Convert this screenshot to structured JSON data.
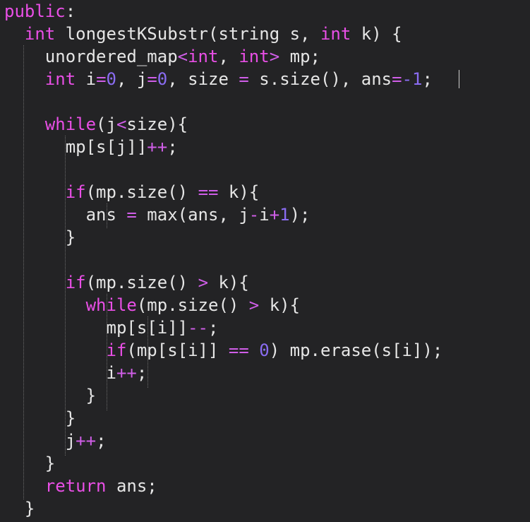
{
  "editor": {
    "theme": {
      "background": "#232325",
      "text": "#e6e6e6",
      "keyword": "#e94fe6",
      "number": "#8a6cf2",
      "operator": "#d05ee8"
    },
    "lines": [
      {
        "indent": 0,
        "row": 0,
        "tokens": [
          [
            "kw",
            "public"
          ],
          [
            "txt",
            ":"
          ]
        ]
      },
      {
        "indent": 1,
        "row": 1,
        "tokens": [
          [
            "kw",
            "int"
          ],
          [
            "txt",
            " longestKSubstr(string s, "
          ],
          [
            "kw",
            "int"
          ],
          [
            "txt",
            " k) {"
          ]
        ]
      },
      {
        "indent": 2,
        "row": 2,
        "tokens": [
          [
            "txt",
            "unordered_map"
          ],
          [
            "op",
            "<"
          ],
          [
            "kw",
            "int"
          ],
          [
            "txt",
            ", "
          ],
          [
            "kw",
            "int"
          ],
          [
            "op",
            ">"
          ],
          [
            "txt",
            " mp;"
          ]
        ]
      },
      {
        "indent": 2,
        "row": 3,
        "tokens": [
          [
            "kw",
            "int"
          ],
          [
            "txt",
            " i"
          ],
          [
            "op",
            "="
          ],
          [
            "num",
            "0"
          ],
          [
            "txt",
            ", j"
          ],
          [
            "op",
            "="
          ],
          [
            "num",
            "0"
          ],
          [
            "txt",
            ", size "
          ],
          [
            "op",
            "="
          ],
          [
            "txt",
            " s.size(), ans"
          ],
          [
            "op",
            "="
          ],
          [
            "num",
            "-1"
          ],
          [
            "txt",
            ";"
          ]
        ]
      },
      {
        "indent": 2,
        "row": 5,
        "tokens": [
          [
            "kw",
            "while"
          ],
          [
            "txt",
            "(j"
          ],
          [
            "op",
            "<"
          ],
          [
            "txt",
            "size){"
          ]
        ]
      },
      {
        "indent": 3,
        "row": 6,
        "tokens": [
          [
            "txt",
            "mp[s[j]]"
          ],
          [
            "op",
            "++"
          ],
          [
            "txt",
            ";"
          ]
        ]
      },
      {
        "indent": 3,
        "row": 8,
        "tokens": [
          [
            "kw",
            "if"
          ],
          [
            "txt",
            "(mp.size() "
          ],
          [
            "op",
            "=="
          ],
          [
            "txt",
            " k){"
          ]
        ]
      },
      {
        "indent": 4,
        "row": 9,
        "tokens": [
          [
            "txt",
            "ans "
          ],
          [
            "op",
            "="
          ],
          [
            "txt",
            " max(ans, j"
          ],
          [
            "op",
            "-"
          ],
          [
            "txt",
            "i"
          ],
          [
            "op",
            "+"
          ],
          [
            "num",
            "1"
          ],
          [
            "txt",
            ");"
          ]
        ]
      },
      {
        "indent": 3,
        "row": 10,
        "tokens": [
          [
            "txt",
            "}"
          ]
        ]
      },
      {
        "indent": 3,
        "row": 12,
        "tokens": [
          [
            "kw",
            "if"
          ],
          [
            "txt",
            "(mp.size() "
          ],
          [
            "op",
            ">"
          ],
          [
            "txt",
            " k){"
          ]
        ]
      },
      {
        "indent": 4,
        "row": 13,
        "tokens": [
          [
            "kw",
            "while"
          ],
          [
            "txt",
            "(mp.size() "
          ],
          [
            "op",
            ">"
          ],
          [
            "txt",
            " k){"
          ]
        ]
      },
      {
        "indent": 5,
        "row": 14,
        "tokens": [
          [
            "txt",
            "mp[s[i]]"
          ],
          [
            "op",
            "--"
          ],
          [
            "txt",
            ";"
          ]
        ]
      },
      {
        "indent": 5,
        "row": 15,
        "tokens": [
          [
            "kw",
            "if"
          ],
          [
            "txt",
            "(mp[s[i]] "
          ],
          [
            "op",
            "=="
          ],
          [
            "txt",
            " "
          ],
          [
            "num",
            "0"
          ],
          [
            "txt",
            ") mp.erase(s[i]);"
          ]
        ]
      },
      {
        "indent": 5,
        "row": 16,
        "tokens": [
          [
            "txt",
            "i"
          ],
          [
            "op",
            "++"
          ],
          [
            "txt",
            ";"
          ]
        ]
      },
      {
        "indent": 4,
        "row": 17,
        "tokens": [
          [
            "txt",
            "}"
          ]
        ]
      },
      {
        "indent": 3,
        "row": 18,
        "tokens": [
          [
            "txt",
            "}"
          ]
        ]
      },
      {
        "indent": 3,
        "row": 19,
        "tokens": [
          [
            "txt",
            "j"
          ],
          [
            "op",
            "++"
          ],
          [
            "txt",
            ";"
          ]
        ]
      },
      {
        "indent": 2,
        "row": 20,
        "tokens": [
          [
            "txt",
            "}"
          ]
        ]
      },
      {
        "indent": 2,
        "row": 21,
        "tokens": [
          [
            "kw",
            "return"
          ],
          [
            "txt",
            " ans;"
          ]
        ]
      },
      {
        "indent": 1,
        "row": 22,
        "tokens": [
          [
            "txt",
            "}"
          ]
        ]
      }
    ]
  }
}
